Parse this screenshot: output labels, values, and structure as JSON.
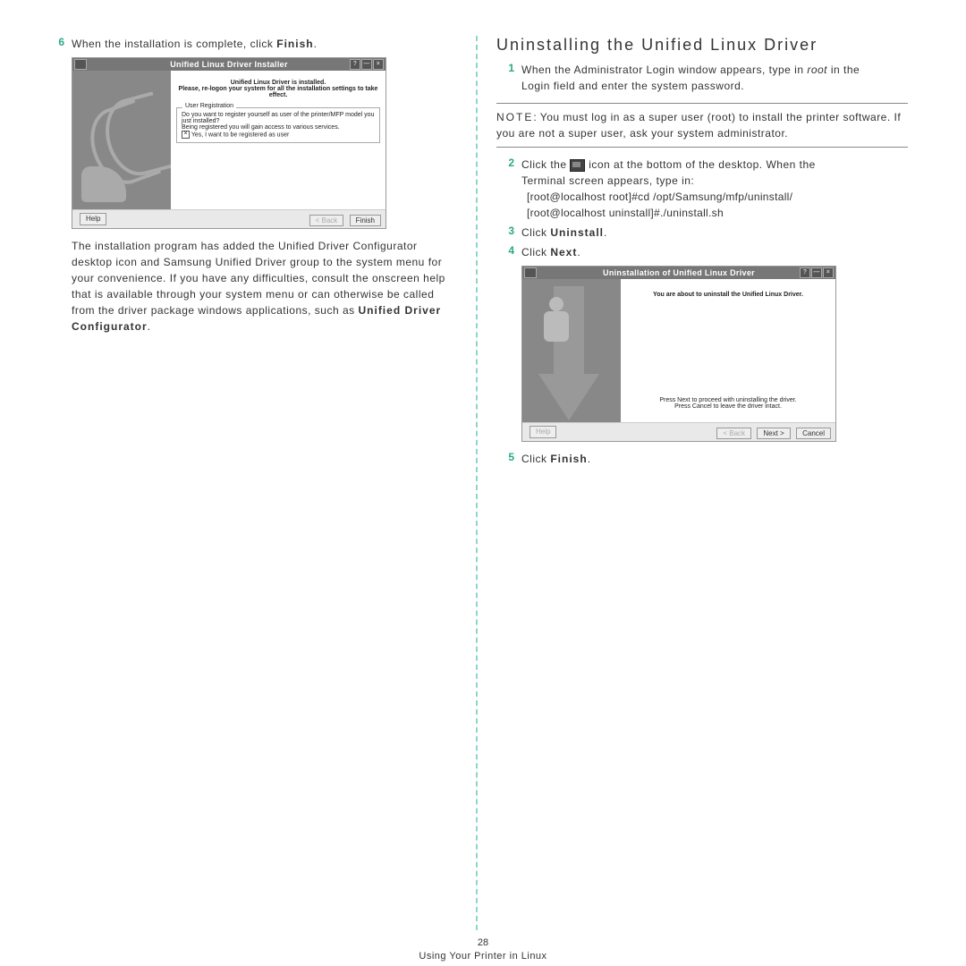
{
  "left": {
    "step6": {
      "num": "6",
      "pre": "When the installation is complete, click ",
      "bold": "Finish",
      "post": "."
    },
    "paragraph": {
      "pre": "The installation program has added the Unified Driver Configurator desktop icon and Samsung Unified Driver group to the system menu for your convenience. If you have any difficulties, consult the onscreen help that is available through your system menu or can otherwise be called from the driver package windows applications, such as ",
      "bold": "Unified Driver Configurator",
      "post": "."
    },
    "screenshot": {
      "title": "Unified Linux Driver Installer",
      "line1": "Unified Linux Driver is installed.",
      "line2": "Please, re-logon your system for all the installation settings to take effect.",
      "fieldset_legend": "User Registration",
      "reg1": "Do you want to register yourself as user of the printer/MFP model you just installed?",
      "reg2": "Being registered you will gain access to various services.",
      "check_label": "Yes, I want to be registered as user",
      "btn_help": "Help",
      "btn_back": "< Back",
      "btn_finish": "Finish"
    }
  },
  "right": {
    "heading": "Uninstalling the Unified Linux Driver",
    "step1": {
      "num": "1",
      "pre": "When the Administrator Login window appears, type in ",
      "italic": "root",
      "post": " in the Login field and enter the system password."
    },
    "note": {
      "label": "NOTE",
      "text": ": You must log in as a super user (root) to install the printer software. If you are not a super user, ask your system administrator."
    },
    "step2": {
      "num": "2",
      "pre": "Click the ",
      "post": " icon at the bottom of the desktop. When the Terminal screen appears, type in:",
      "code1": "[root@localhost root]#cd /opt/Samsung/mfp/uninstall/",
      "code2": "[root@localhost uninstall]#./uninstall.sh"
    },
    "step3": {
      "num": "3",
      "pre": "Click ",
      "bold": "Uninstall",
      "post": "."
    },
    "step4": {
      "num": "4",
      "pre": "Click ",
      "bold": "Next",
      "post": "."
    },
    "step5": {
      "num": "5",
      "pre": "Click ",
      "bold": "Finish",
      "post": "."
    },
    "screenshot": {
      "title": "Uninstallation of Unified Linux Driver",
      "line1": "You are about to uninstall the Unified Linux Driver.",
      "line2": "Press Next to proceed with uninstalling the driver.",
      "line3": "Press Cancel to leave the driver intact.",
      "btn_help": "Help",
      "btn_back": "< Back",
      "btn_next": "Next >",
      "btn_cancel": "Cancel"
    }
  },
  "footer": {
    "page": "28",
    "caption": "Using Your Printer in Linux"
  }
}
